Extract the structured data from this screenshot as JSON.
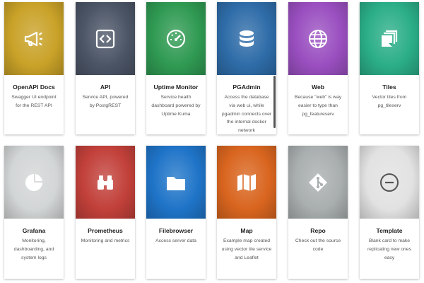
{
  "cards": [
    {
      "title": "OpenAPI Docs",
      "description": "Swagger UI endpoint for the REST API",
      "icon": "megaphone-icon",
      "color": "#c9a228"
    },
    {
      "title": "API",
      "description": "Service API, powered by PostgREST",
      "icon": "code-icon",
      "color": "#4b5566"
    },
    {
      "title": "Uptime Monitor",
      "description": "Service health dashboard powered by Uptime Kuma",
      "icon": "speedometer-icon",
      "color": "#2f9a52"
    },
    {
      "title": "PGAdmin",
      "description": "Access the database via web ui, while pgadmin connects over the internal docker network",
      "icon": "database-icon",
      "color": "#2e6ca8"
    },
    {
      "title": "Web",
      "description": "Because \"web\" is way easier to type than pg_featureserv",
      "icon": "globe-icon",
      "color": "#9a4fc0"
    },
    {
      "title": "Tiles",
      "description": "Vector tiles from pg_tileserv",
      "icon": "tiles-icon",
      "color": "#2bae88"
    },
    {
      "title": "Grafana",
      "description": "Monitoring, dashboarding, and system logs",
      "icon": "pie-chart-icon",
      "color": "#d3d6d6"
    },
    {
      "title": "Prometheus",
      "description": "Monitoring and metrics",
      "icon": "binoculars-icon",
      "color": "#c2403a"
    },
    {
      "title": "Filebrowser",
      "description": "Access server data",
      "icon": "folder-icon",
      "color": "#1f74c8"
    },
    {
      "title": "Map",
      "description": "Example map created using vector tile service and Leaflet",
      "icon": "map-icon",
      "color": "#d9651f"
    },
    {
      "title": "Repo",
      "description": "Check out the source code",
      "icon": "git-icon",
      "color": "#a9aeae"
    },
    {
      "title": "Template",
      "description": "Blank card to make replicating new ones easy",
      "icon": "minus-circle-icon",
      "color": "#e2e2e2"
    }
  ]
}
